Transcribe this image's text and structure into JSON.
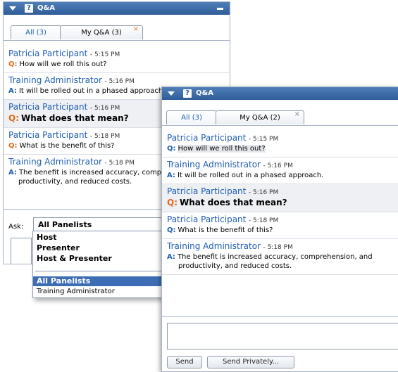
{
  "back_panel": {
    "title": "Q&A",
    "tabs": [
      {
        "label": "All (3)"
      },
      {
        "label": "My Q&A (3)",
        "close": "×"
      }
    ],
    "items": [
      {
        "name": "Patricia Participant",
        "time": "- 5:15 PM",
        "prefix": "Q:",
        "text": "How will we roll this out?"
      },
      {
        "name": "Training Administrator",
        "time": "- 5:16 PM",
        "prefix": "A:",
        "text": "It will be rolled out in a phased approach"
      },
      {
        "name": "Patricia Participant",
        "time": "- 5:16 PM",
        "prefix": "Q:",
        "text": "What does that mean?"
      },
      {
        "name": "Patricia Participant",
        "time": "- 5:18 PM",
        "prefix": "Q:",
        "text": "What is the benefit of this?"
      },
      {
        "name": "Training Administrator",
        "time": "- 5:18 PM",
        "prefix": "A:",
        "text": "The benefit is increased accuracy, compr",
        "text2": "productivity, and reduced costs."
      }
    ],
    "ask_label": "Ask:",
    "ask_selected": "All Panelists",
    "dropdown_options": [
      "Host",
      "Presenter",
      "Host & Presenter",
      "All Panelists",
      "Training Administrator"
    ]
  },
  "front_panel": {
    "title": "Q&A",
    "tabs": [
      {
        "label": "All (3)"
      },
      {
        "label": "My Q&A (2)",
        "close": "×"
      }
    ],
    "items": [
      {
        "name": "Patricia Participant",
        "time": "- 5:15 PM",
        "prefix": "Q:",
        "text": "How will we roll this out?"
      },
      {
        "name": "Training Administrator",
        "time": "- 5:16 PM",
        "prefix": "A:",
        "text": "It will be rolled out in a phased approach."
      },
      {
        "name": "Patricia Participant",
        "time": "- 5:16 PM",
        "prefix": "Q:",
        "text": "What does that mean?"
      },
      {
        "name": "Patricia Participant",
        "time": "- 5:18 PM",
        "prefix": "Q:",
        "text": "What is the benefit of this?"
      },
      {
        "name": "Training Administrator",
        "time": "- 5:18 PM",
        "prefix": "A:",
        "text": "The benefit is increased accuracy, comprehension, and",
        "text2": "productivity, and reduced costs."
      }
    ],
    "send_label": "Send",
    "send_privately_label": "Send Privately..."
  },
  "colors": {
    "title_bar": "#2e5c97",
    "name_blue": "#1f5fb4",
    "question_orange": "#e06a1a",
    "selection_blue": "#3d6db5"
  },
  "icons": [
    "collapse-arrow-icon",
    "qa-icon",
    "minimize-icon",
    "close-tab-icon"
  ]
}
